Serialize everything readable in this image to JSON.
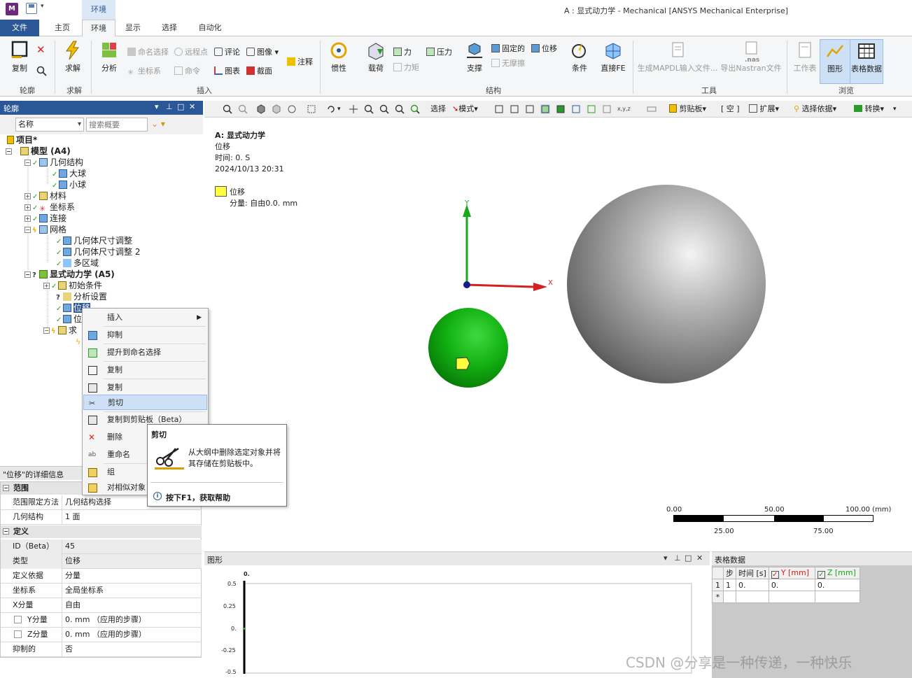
{
  "title_bar": {
    "logo_letter": "M",
    "context_tab": "环境",
    "window_title": "A : 显式动力学 - Mechanical [ANSYS Mechanical Enterprise]"
  },
  "tabs": {
    "file": "文件",
    "home": "主页",
    "environment": "环境",
    "display": "显示",
    "selection": "选择",
    "automation": "自动化"
  },
  "ribbon": {
    "outline": {
      "copy": "复制",
      "group": "轮廓"
    },
    "solve": {
      "solve": "求解",
      "group": "求解"
    },
    "insert": {
      "analysis": "分析",
      "named_selection": "命名选择",
      "remote_point": "远程点",
      "comment": "评论",
      "image": "图像",
      "coordinate_system": "坐标系",
      "command": "命令",
      "chart": "图表",
      "section": "截面",
      "annotation": "注释",
      "group": "插入"
    },
    "structure": {
      "inertia": "惯性",
      "load": "载荷",
      "force": "力",
      "pressure": "压力",
      "moment": "力矩",
      "support": "支撑",
      "fixed": "固定的",
      "displacement": "位移",
      "frictionless": "无摩擦",
      "condition": "条件",
      "direct_fe": "直接FE",
      "group": "结构"
    },
    "tools": {
      "gen_mapdl": "生成MAPDL输入文件...",
      "nas_tag": ".nas",
      "export_nastran": "导出Nastran文件",
      "group": "工具"
    },
    "browse": {
      "worksheet": "工作表",
      "graph": "图形",
      "tabular": "表格数据",
      "group": "浏览"
    }
  },
  "outline": {
    "title": "轮廓",
    "filter_value": "名称",
    "search_placeholder": "搜索概要",
    "tree": {
      "project": "项目*",
      "model": "模型 (A4)",
      "geometry": "几何结构",
      "big_ball": "大球",
      "small_ball": "小球",
      "materials": "材料",
      "coord_systems": "坐标系",
      "connections": "连接",
      "mesh": "网格",
      "body_sizing_1": "几何体尺寸调整",
      "body_sizing_2": "几何体尺寸调整 2",
      "multizone": "多区域",
      "explicit": "显式动力学 (A5)",
      "initial_conditions": "初始条件",
      "analysis_settings": "分析设置",
      "displacement_sel": "位移",
      "displacement_2": "位",
      "solution": "求"
    }
  },
  "details": {
    "title": "\"位移\"的详细信息",
    "sections": {
      "scope": "范围",
      "definition": "定义"
    },
    "rows": {
      "scoping_method": {
        "k": "范围限定方法",
        "v": "几何结构选择"
      },
      "geometry": {
        "k": "几何结构",
        "v": "1 面"
      },
      "id": {
        "k": "ID（Beta）",
        "v": "45"
      },
      "type": {
        "k": "类型",
        "v": "位移"
      },
      "define_by": {
        "k": "定义依据",
        "v": "分量"
      },
      "coord_sys": {
        "k": "坐标系",
        "v": "全局坐标系"
      },
      "x_comp": {
        "k": "X分量",
        "v": "自由"
      },
      "y_comp": {
        "k": "Y分量",
        "v": "0. mm （应用的步骤）"
      },
      "z_comp": {
        "k": "Z分量",
        "v": "0. mm （应用的步骤）"
      },
      "suppressed": {
        "k": "抑制的",
        "v": "否"
      }
    }
  },
  "viewport_toolbar": {
    "select": "选择",
    "mode": "模式",
    "clipboard": "剪贴板",
    "empty": "[ 空 ]",
    "extend": "扩展",
    "select_by": "选择依据",
    "convert": "转换"
  },
  "viewport": {
    "analysis_title": "A: 显式动力学",
    "object": "位移",
    "time": "时间: 0. S",
    "date": "2024/10/13 20:31",
    "legend_name": "位移",
    "legend_comp": "分量: 自由0.0. mm",
    "axis_x": "X",
    "axis_y": "Y",
    "scale": {
      "t0": "0.00",
      "t50": "50.00",
      "t100": "100.00 (mm)",
      "t25": "25.00",
      "t75": "75.00"
    }
  },
  "graph": {
    "title": "图形",
    "time_label": "0.",
    "y_ticks": [
      "0.5",
      "0.25",
      "0.",
      "-0.25",
      "-0.5"
    ]
  },
  "table": {
    "title": "表格数据",
    "headers": {
      "step": "步",
      "time": "时间 [s]",
      "y": "Y [mm]",
      "z": "Z [mm]"
    },
    "row1": {
      "idx": "1",
      "step": "1",
      "time": "0.",
      "y": "0.",
      "z": "0."
    },
    "new_row_marker": "*"
  },
  "context_menu": {
    "insert": "插入",
    "suppress": "抑制",
    "promote": "提升到命名选择",
    "duplicate": "复制",
    "copy": "复制",
    "cut": "剪切",
    "copy_clipboard": "复制到剪贴板（Beta）",
    "delete": "删除",
    "rename": "重命名",
    "group": "组",
    "group_similar": "对相似对象"
  },
  "tooltip": {
    "title": "剪切",
    "description": "从大纲中删除选定对象并将其存储在剪贴板中。",
    "help": "按下F1，获取帮助"
  },
  "watermark": "CSDN @分享是一种传递，一种快乐",
  "colors": {
    "accent": "#2b5797",
    "selection_green": "#1aa81a",
    "legend_yellow": "#ffff40"
  }
}
